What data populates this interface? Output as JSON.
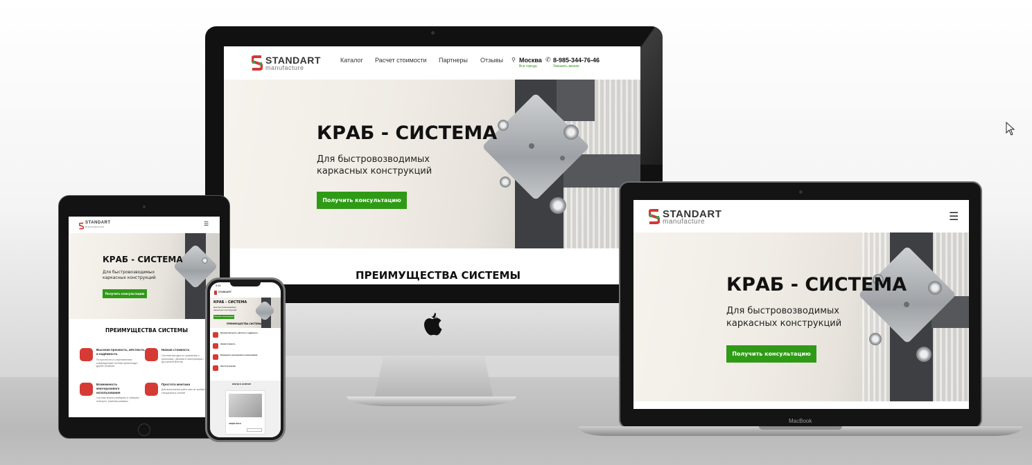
{
  "brand": {
    "name": "STANDART",
    "sub": "manufacture"
  },
  "nav": {
    "items": [
      "Каталог",
      "Расчет стоимости",
      "Партнеры",
      "Отзывы"
    ],
    "city": "Москва",
    "city_sub": "Все города",
    "phone": "8-985-344-76-46",
    "phone_sub": "Заказать звонок"
  },
  "hero": {
    "title": "КРАБ - СИСТЕМА",
    "subtitle_line1": "Для быстровозводимых",
    "subtitle_line2": "каркасных конструкций",
    "cta": "Получить консультацию"
  },
  "advantages": {
    "title": "ПРЕИМУЩЕСТВА СИСТЕМЫ",
    "items": [
      {
        "title": "Высокая прочность, жёсткость и надёжность",
        "text": "По прочности и сопротивлению повреждениям система превосходит другие решения"
      },
      {
        "title": "Низкая стоимость",
        "text": "Система выгодна по сравнению с аналогами • Дёшево в эксплуатации • Доступный монтаж"
      },
      {
        "title": "Возможность многоразового использования",
        "text": "Систему можно разбирать и собирать повторно, изменяя размеры"
      },
      {
        "title": "Простота монтажа",
        "text": "Для выполнения работ вам не требуется специальных знаний"
      }
    ]
  },
  "phone_screen": {
    "status_time": "9:41",
    "in_stock": "ВСЕГДА В НАЛИЧИИ",
    "product_price": "АКЦИЯ 3500 ₽"
  },
  "laptop": {
    "label": "MacBook"
  },
  "colors": {
    "accent": "#2f9a16",
    "icon_red": "#d63a34",
    "logo_green": "#3aa34a",
    "logo_red": "#d1383a"
  }
}
